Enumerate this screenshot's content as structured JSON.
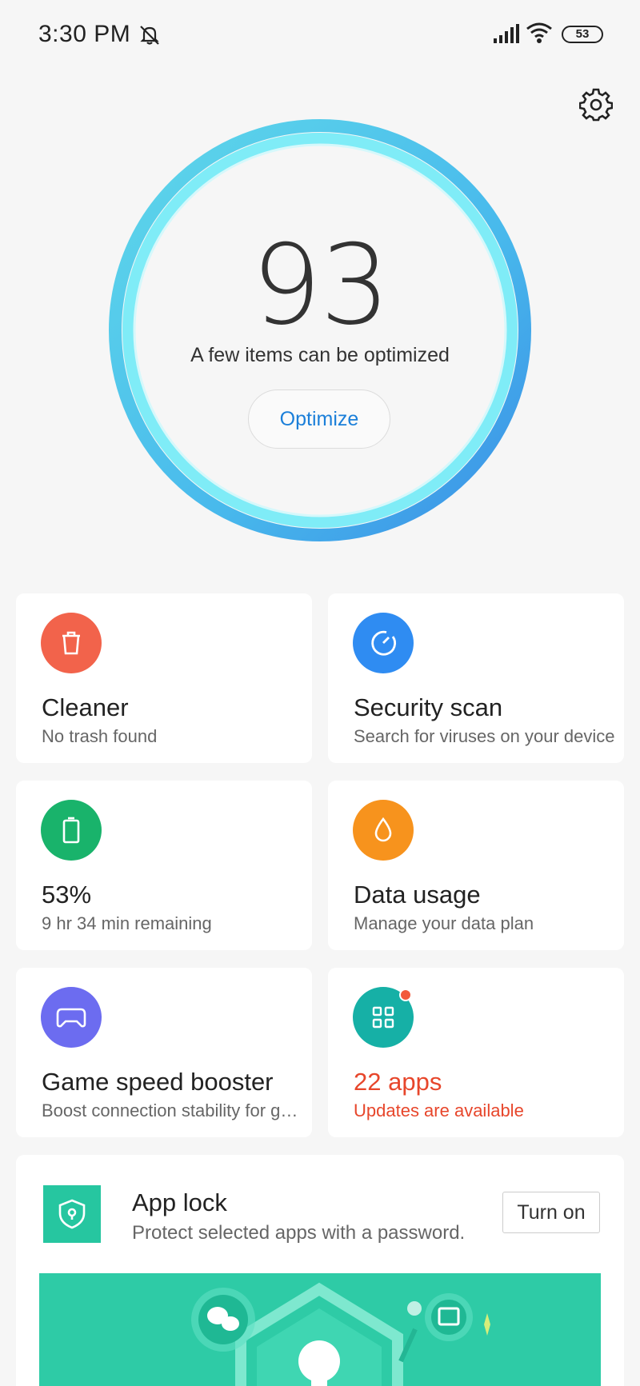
{
  "status_bar": {
    "time": "3:30 PM",
    "dnd_icon": "bell-off-icon",
    "signal_icon": "signal-icon",
    "wifi_icon": "wifi-icon",
    "battery_level": "53"
  },
  "header": {
    "settings_icon": "gear-icon"
  },
  "score": {
    "value": "93",
    "caption": "A few items can be optimized",
    "button_label": "Optimize"
  },
  "cards": [
    {
      "id": "cleaner",
      "title": "Cleaner",
      "subtitle": "No trash found",
      "icon": "trash-icon",
      "color": "#f2634b"
    },
    {
      "id": "security",
      "title": "Security scan",
      "subtitle": "Search for viruses on your device",
      "icon": "gauge-icon",
      "color": "#2f8cf2"
    },
    {
      "id": "battery",
      "title": "53%",
      "subtitle": "9 hr 34 min  remaining",
      "icon": "battery-icon",
      "color": "#19b36b"
    },
    {
      "id": "data",
      "title": "Data usage",
      "subtitle": "Manage your data plan",
      "icon": "drop-icon",
      "color": "#f7931d"
    },
    {
      "id": "game",
      "title": "Game speed booster",
      "subtitle": "Boost connection stability for games",
      "icon": "gamepad-icon",
      "color": "#6c6cf0"
    },
    {
      "id": "apps",
      "title": "22 apps",
      "subtitle": "Updates are available",
      "icon": "grid-icon",
      "color": "#16b0a6"
    }
  ],
  "app_lock": {
    "title": "App lock",
    "subtitle": "Protect selected apps with a password.",
    "button_label": "Turn on",
    "icon": "shield-lock-icon",
    "color": "#26c6a0"
  }
}
